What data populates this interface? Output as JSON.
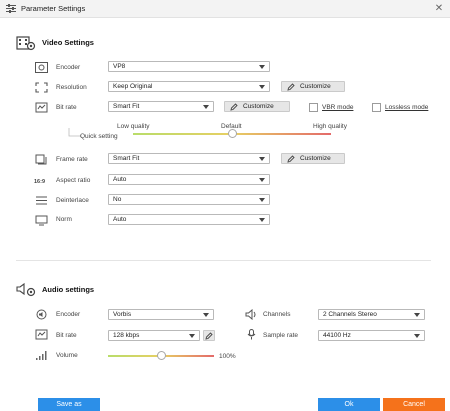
{
  "window": {
    "title": "Parameter Settings"
  },
  "video": {
    "heading": "Video Settings",
    "encoder": {
      "label": "Encoder",
      "value": "VP8"
    },
    "resolution": {
      "label": "Resolution",
      "value": "Keep Original",
      "customize": "Customize"
    },
    "bitrate": {
      "label": "Bit rate",
      "value": "Smart Fit",
      "customize": "Customize",
      "vbr": "VBR mode",
      "lossless": "Lossless mode"
    },
    "quality": {
      "label": "Quick setting",
      "low": "Low quality",
      "default": "Default",
      "high": "High quality",
      "level": 0.5
    },
    "framerate": {
      "label": "Frame rate",
      "value": "Smart Fit",
      "customize": "Customize"
    },
    "aspect": {
      "label": "Aspect ratio",
      "value": "Auto"
    },
    "deinterlace": {
      "label": "Deinterlace",
      "value": "No"
    },
    "norm": {
      "label": "Norm",
      "value": "Auto"
    }
  },
  "audio": {
    "heading": "Audio settings",
    "encoder": {
      "label": "Encoder",
      "value": "Vorbis"
    },
    "bitrate": {
      "label": "Bit rate",
      "value": "128 kbps"
    },
    "volume": {
      "label": "Volume",
      "value": "100%",
      "level": 0.5
    },
    "channels": {
      "label": "Channels",
      "value": "2 Channels Stereo"
    },
    "samplerate": {
      "label": "Sample rate",
      "value": "44100 Hz"
    }
  },
  "footer": {
    "save_as": "Save as",
    "ok": "Ok",
    "cancel": "Cancel"
  },
  "colors": {
    "accent_blue": "#2c8fe8",
    "cancel_orange": "#f5721b"
  }
}
